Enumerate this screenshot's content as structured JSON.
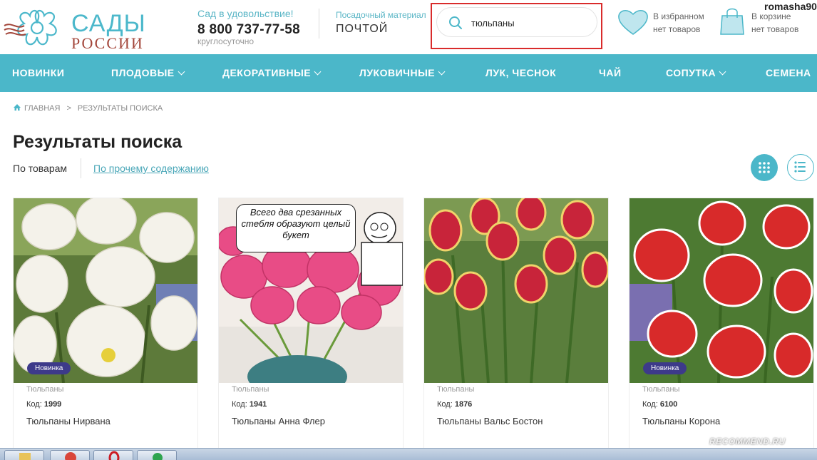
{
  "header": {
    "logo_line1": "САДЫ",
    "logo_line2": "РОССИИ",
    "slogan": "Сад в удовольствие!",
    "phone": "8 800 737-77-58",
    "hours": "круглосуточно",
    "mail_sub": "Посадочный материал",
    "mail_main": "ПОЧТОЙ",
    "search_value": "тюльпаны",
    "favorites_line1": "В избранном",
    "favorites_line2": "нет товаров",
    "cart_line1": "В корзине",
    "cart_line2": "нет товаров",
    "username": "romasha90"
  },
  "nav": {
    "items": [
      {
        "label": "НОВИНКИ",
        "dropdown": false
      },
      {
        "label": "ПЛОДОВЫЕ",
        "dropdown": true
      },
      {
        "label": "ДЕКОРАТИВНЫЕ",
        "dropdown": true
      },
      {
        "label": "ЛУКОВИЧНЫЕ",
        "dropdown": true
      },
      {
        "label": "ЛУК, ЧЕСНОК",
        "dropdown": false
      },
      {
        "label": "ЧАЙ",
        "dropdown": false
      },
      {
        "label": "СОПУТКА",
        "dropdown": true
      },
      {
        "label": "СЕМЕНА",
        "dropdown": true
      }
    ]
  },
  "breadcrumb": {
    "home": "ГЛАВНАЯ",
    "separator": ">",
    "current": "РЕЗУЛЬТАТЫ ПОИСКА"
  },
  "page_title": "Результаты поиска",
  "filters": {
    "products": "По товарам",
    "content": "По прочему содержанию"
  },
  "code_label": "Код:",
  "products": [
    {
      "category": "Тюльпаны",
      "code": "1999",
      "name": "Тюльпаны Нирвана",
      "badge": "Новинка"
    },
    {
      "category": "Тюльпаны",
      "code": "1941",
      "name": "Тюльпаны Анна Флер",
      "badge": "",
      "bubble": "Всего два срезанных стебля образуют целый букет"
    },
    {
      "category": "Тюльпаны",
      "code": "1876",
      "name": "Тюльпаны Вальс Бостон",
      "badge": ""
    },
    {
      "category": "Тюльпаны",
      "code": "6100",
      "name": "Тюльпаны Корона",
      "badge": "Новинка"
    }
  ],
  "watermark": "RECOMMEND.RU",
  "colors": {
    "accent": "#4bb7c9",
    "badge": "#3d3a8a",
    "highlight_frame": "#d92b2b",
    "logo_red": "#a3463a"
  }
}
